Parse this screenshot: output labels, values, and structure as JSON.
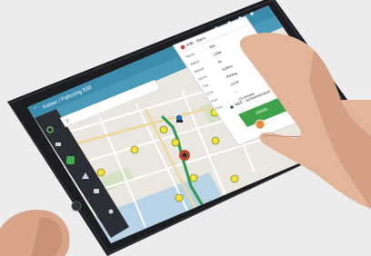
{
  "app": {
    "title": "Kaiser / Pahoring 830",
    "status_icons": [
      "dots-icon",
      "edit-icon",
      "globe-icon",
      "grid-icon"
    ]
  },
  "sidebar": {
    "items": [
      {
        "icon": "check-circle-icon"
      },
      {
        "icon": "truck-icon"
      },
      {
        "icon": "route-icon",
        "active": true
      },
      {
        "icon": "warning-icon"
      },
      {
        "icon": "chat-icon"
      },
      {
        "icon": "gear-icon"
      }
    ]
  },
  "search": {
    "placeholder": ""
  },
  "popup": {
    "header": "KIB - Stern",
    "rows": [
      {
        "k": "Name",
        "v": "850"
      },
      {
        "k": "Status",
        "v": "LOW"
      },
      {
        "k": "Speed",
        "v": "40"
      },
      {
        "k": "Driver",
        "v": "Soffren"
      },
      {
        "k": "Trip",
        "v": "Pehling"
      },
      {
        "k": "ETA",
        "v": "13:24"
      },
      {
        "k": "Fuel",
        "v": "—"
      },
      {
        "k": "Time",
        "v": "15 minutes"
      }
    ],
    "footer": "NBG - Schwantenstorf",
    "action_label": "Details"
  },
  "colors": {
    "accent": "#3e8fb0",
    "toolbar": "#3b8cad",
    "route": "#2e9a4f",
    "stop": "#f2e23a",
    "map_bg": "#e8e6df"
  }
}
